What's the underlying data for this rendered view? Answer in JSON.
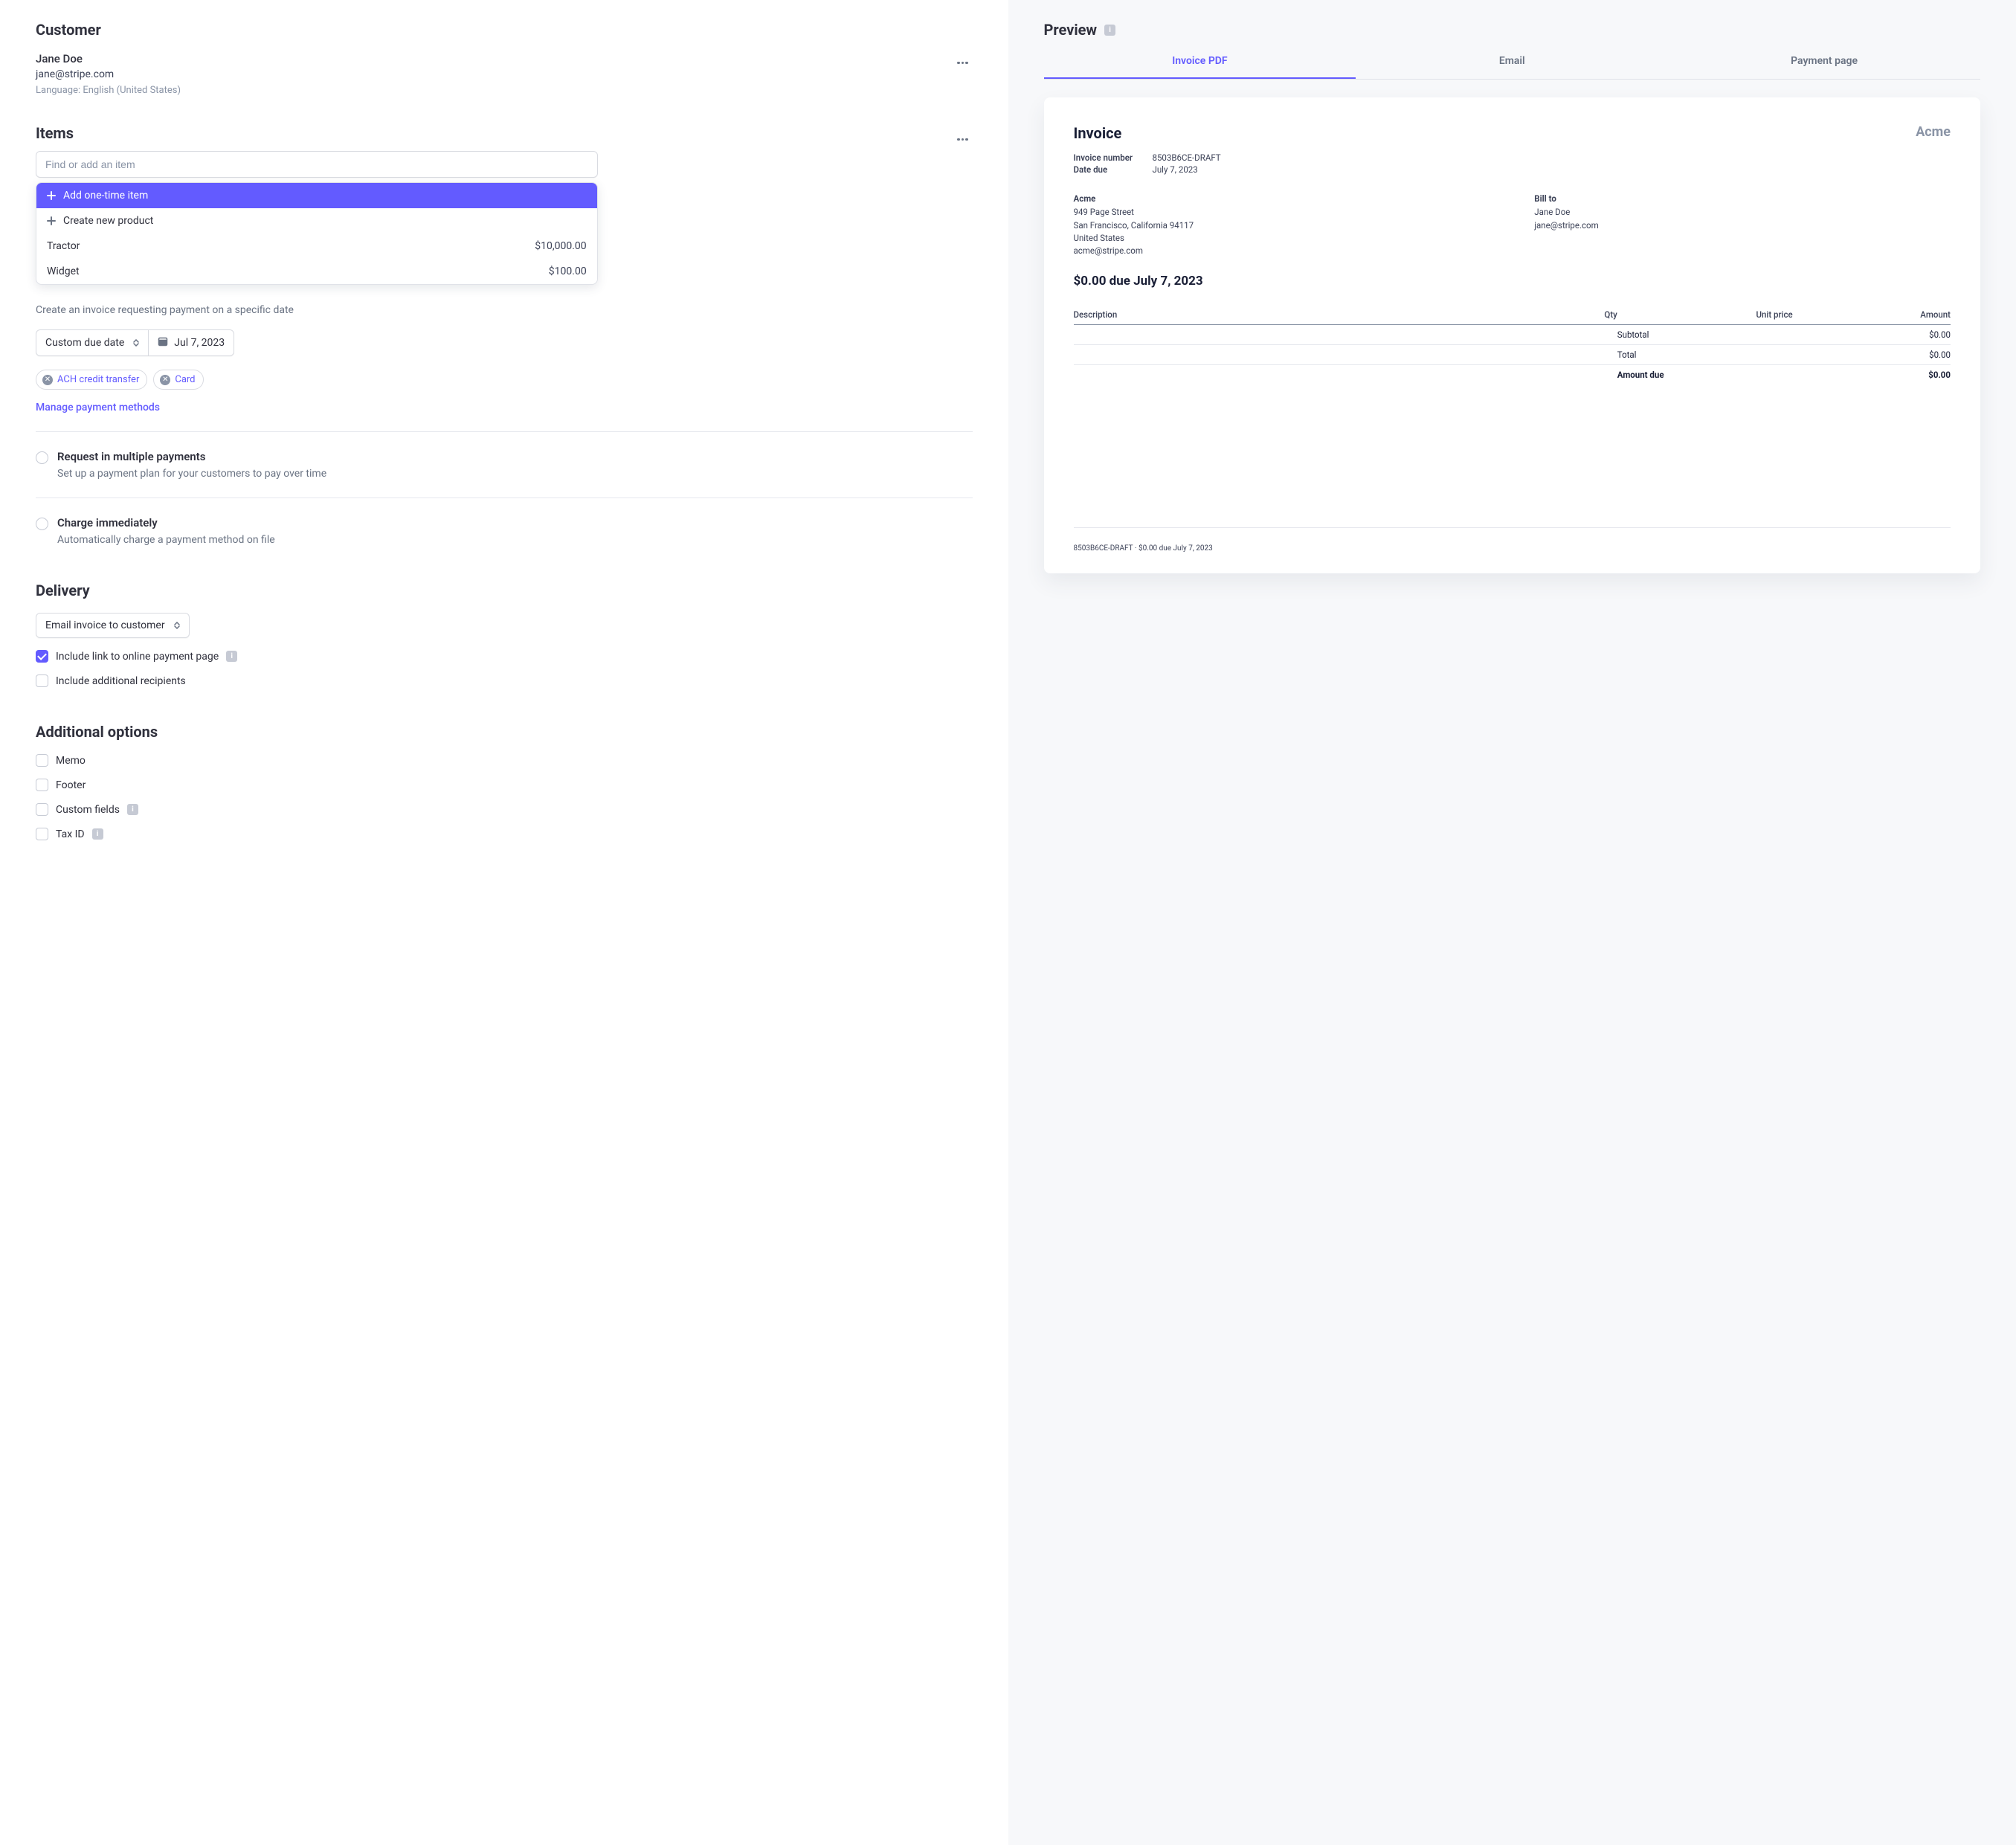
{
  "customer": {
    "heading": "Customer",
    "name": "Jane Doe",
    "email": "jane@stripe.com",
    "language": "Language: English (United States)"
  },
  "items": {
    "heading": "Items",
    "placeholder": "Find or add an item",
    "dropdown": {
      "add_one_time": "Add one-time item",
      "create_product": "Create new product",
      "existing": [
        {
          "name": "Tractor",
          "price": "$10,000.00"
        },
        {
          "name": "Widget",
          "price": "$100.00"
        }
      ]
    }
  },
  "payment": {
    "desc": "Create an invoice requesting payment on a specific date",
    "due_mode": "Custom due date",
    "due_date": "Jul 7, 2023",
    "methods": [
      "ACH credit transfer",
      "Card"
    ],
    "manage_link": "Manage payment methods",
    "multi_title": "Request in multiple payments",
    "multi_desc": "Set up a payment plan for your customers to pay over time",
    "charge_title": "Charge immediately",
    "charge_desc": "Automatically charge a payment method on file"
  },
  "delivery": {
    "heading": "Delivery",
    "method": "Email invoice to customer",
    "include_link": "Include link to online payment page",
    "include_additional": "Include additional recipients"
  },
  "additional": {
    "heading": "Additional options",
    "options": [
      "Memo",
      "Footer",
      "Custom fields",
      "Tax ID"
    ]
  },
  "preview": {
    "heading": "Preview",
    "tabs": [
      "Invoice PDF",
      "Email",
      "Payment page"
    ],
    "invoice": {
      "title": "Invoice",
      "company": "Acme",
      "number_label": "Invoice number",
      "number": "8503B6CE-DRAFT",
      "date_due_label": "Date due",
      "date_due": "July 7, 2023",
      "from": {
        "name": "Acme",
        "line1": "949 Page Street",
        "line2": "San Francisco, California 94117",
        "line3": "United States",
        "email": "acme@stripe.com"
      },
      "to": {
        "heading": "Bill to",
        "name": "Jane Doe",
        "email": "jane@stripe.com"
      },
      "due_line": "$0.00 due July 7, 2023",
      "columns": [
        "Description",
        "Qty",
        "Unit price",
        "Amount"
      ],
      "summary": [
        {
          "label": "Subtotal",
          "value": "$0.00"
        },
        {
          "label": "Total",
          "value": "$0.00"
        },
        {
          "label": "Amount due",
          "value": "$0.00"
        }
      ],
      "footer": "8503B6CE-DRAFT · $0.00 due July 7, 2023"
    }
  }
}
